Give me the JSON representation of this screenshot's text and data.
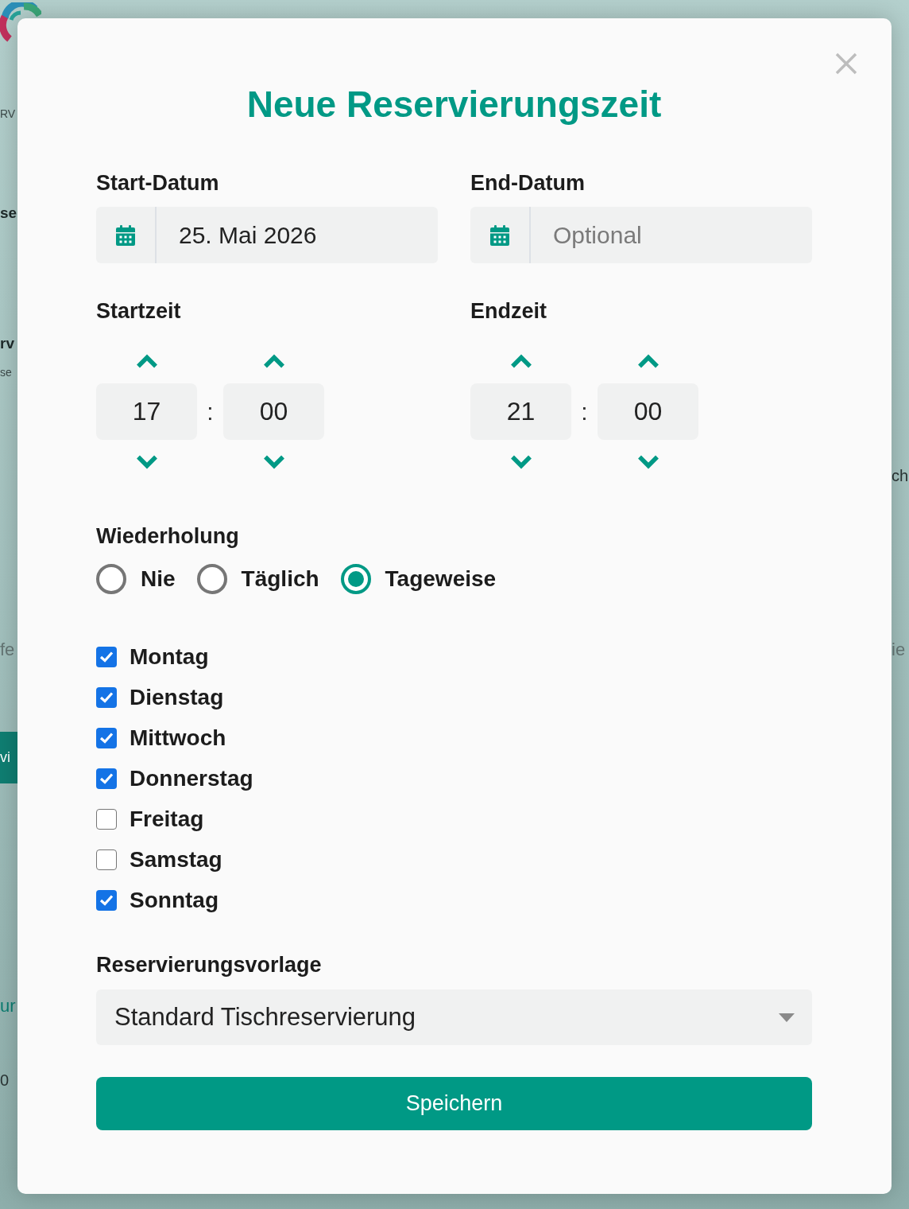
{
  "backdrop": {
    "left_edge": [
      {
        "text": "RV",
        "kind": "small"
      },
      {
        "text": "se",
        "kind": "heading"
      },
      {
        "text": "rv",
        "kind": "heading"
      },
      {
        "text": "se",
        "kind": "small"
      },
      {
        "text": "fe",
        "kind": "muted"
      },
      {
        "text": "vi",
        "kind": "button"
      },
      {
        "text": "ur",
        "kind": "link"
      },
      {
        "text": "0",
        "kind": "text"
      }
    ],
    "right_edge": [
      {
        "text": "ch",
        "kind": "text"
      },
      {
        "text": "ie",
        "kind": "muted"
      }
    ]
  },
  "dialog": {
    "title": "Neue Reservierungszeit",
    "start_date": {
      "label": "Start-Datum",
      "value": "25. Mai 2026"
    },
    "end_date": {
      "label": "End-Datum",
      "placeholder": "Optional"
    },
    "start_time": {
      "label": "Startzeit",
      "hours": "17",
      "separator": ":",
      "minutes": "00"
    },
    "end_time": {
      "label": "Endzeit",
      "hours": "21",
      "separator": ":",
      "minutes": "00"
    },
    "repeat": {
      "label": "Wiederholung",
      "options": [
        {
          "label": "Nie",
          "selected": false
        },
        {
          "label": "Täglich",
          "selected": false
        },
        {
          "label": "Tageweise",
          "selected": true
        }
      ]
    },
    "weekdays": [
      {
        "label": "Montag",
        "checked": true
      },
      {
        "label": "Dienstag",
        "checked": true
      },
      {
        "label": "Mittwoch",
        "checked": true
      },
      {
        "label": "Donnerstag",
        "checked": true
      },
      {
        "label": "Freitag",
        "checked": false
      },
      {
        "label": "Samstag",
        "checked": false
      },
      {
        "label": "Sonntag",
        "checked": true
      }
    ],
    "template": {
      "label": "Reservierungsvorlage",
      "value": "Standard Tischreservierung"
    },
    "save_button": "Speichern"
  }
}
